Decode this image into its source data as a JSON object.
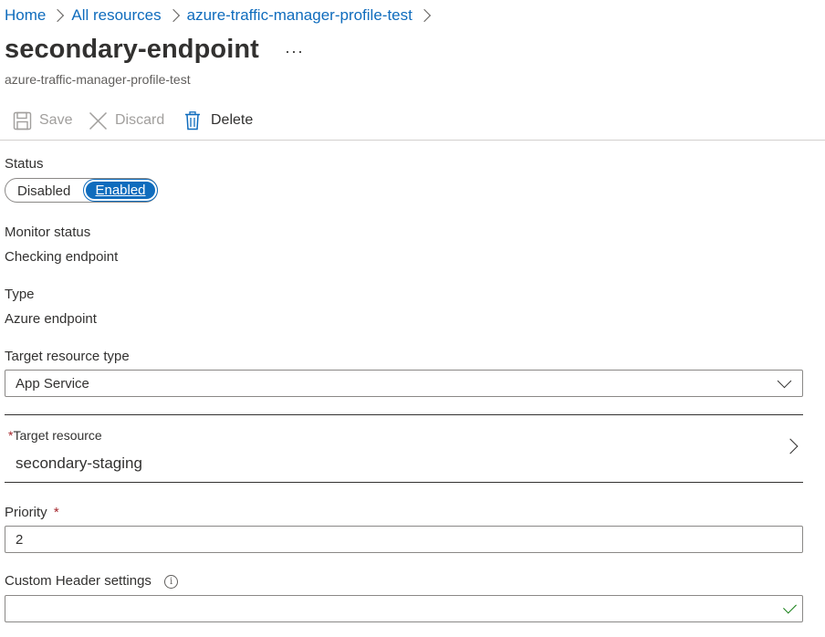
{
  "breadcrumb": {
    "items": [
      "Home",
      "All resources",
      "azure-traffic-manager-profile-test"
    ]
  },
  "header": {
    "title": "secondary-endpoint",
    "more": "···",
    "subtitle": "azure-traffic-manager-profile-test"
  },
  "toolbar": {
    "save_label": "Save",
    "discard_label": "Discard",
    "delete_label": "Delete"
  },
  "status": {
    "label": "Status",
    "options": [
      "Disabled",
      "Enabled"
    ],
    "selected": "Enabled"
  },
  "monitor": {
    "label": "Monitor status",
    "value": "Checking endpoint"
  },
  "type": {
    "label": "Type",
    "value": "Azure endpoint"
  },
  "target_resource_type": {
    "label": "Target resource type",
    "value": "App Service"
  },
  "target_resource": {
    "required": "*",
    "label": "Target resource",
    "value": "secondary-staging"
  },
  "priority": {
    "label": "Priority",
    "required": "*",
    "value": "2"
  },
  "custom_header": {
    "label": "Custom Header settings",
    "info": "i",
    "value": ""
  },
  "colors": {
    "link": "#0f6cbd",
    "accent": "#0f6cbd",
    "required": "#a4262c",
    "valid": "#107c10"
  }
}
